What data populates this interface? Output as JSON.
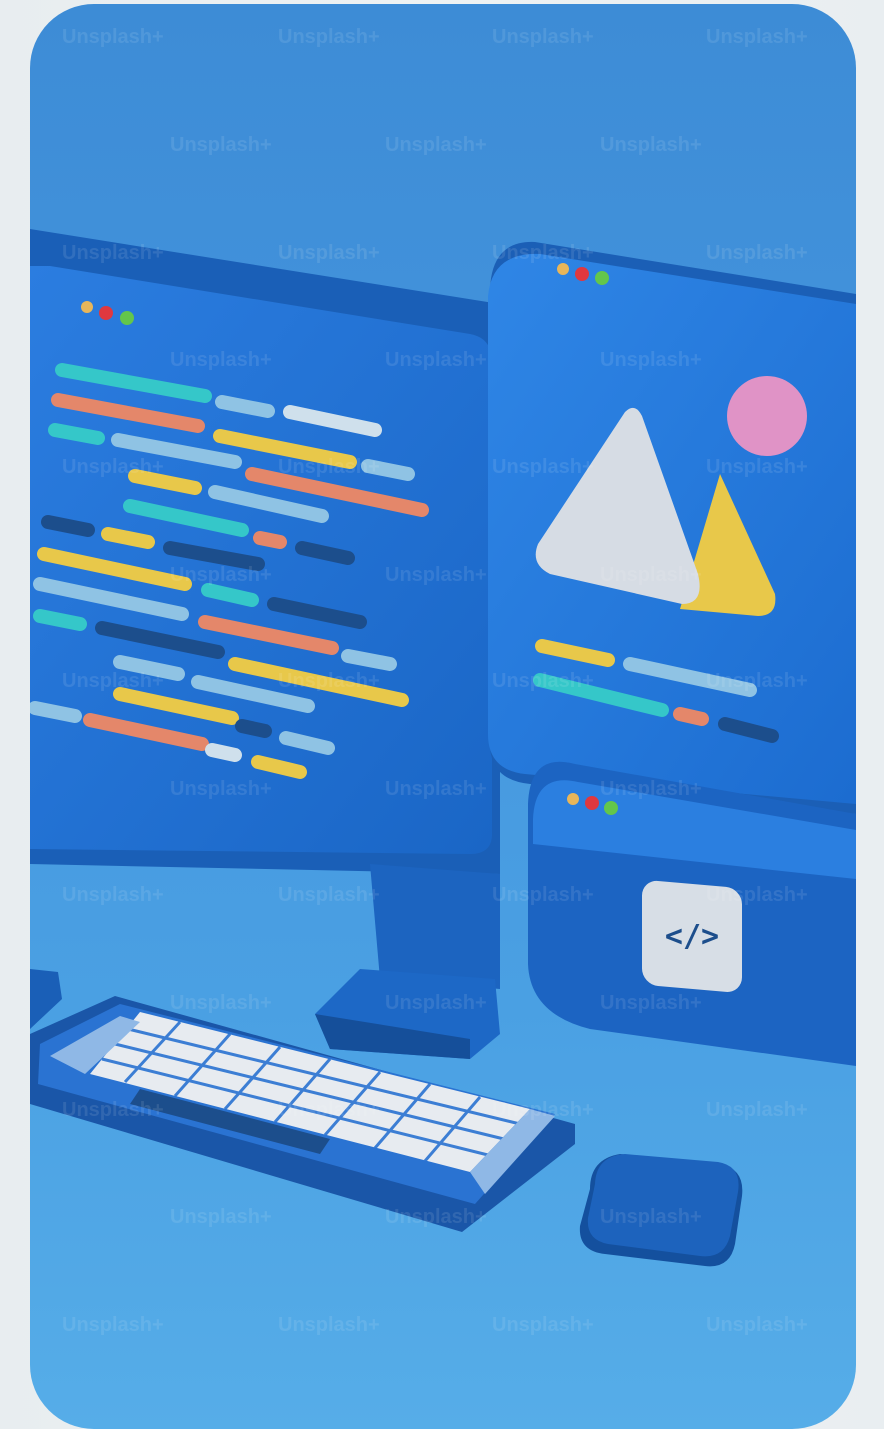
{
  "watermark": {
    "text": "Unsplash+",
    "color": "rgba(255,255,255,0.10)"
  },
  "scene": {
    "code_tag_glyph": "</>",
    "colors": {
      "background": "#4596de",
      "device_blue": "#1f6fd1",
      "code_teal": "#35c7c9",
      "code_orange": "#e4876a",
      "code_yellow": "#e8c84a",
      "code_light": "#8fc3e4",
      "code_dark": "#1c4e8c",
      "sun_pink": "#e093c6",
      "mountain_grey": "#d6dce4"
    }
  }
}
